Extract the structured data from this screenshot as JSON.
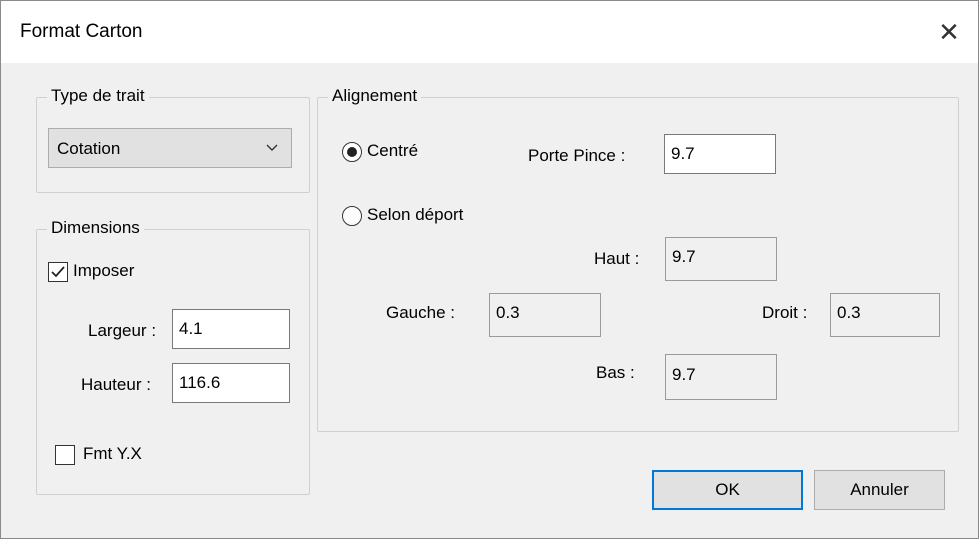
{
  "window": {
    "title": "Format Carton",
    "close_label": "✕"
  },
  "type_de_trait": {
    "label": "Type de trait",
    "selected": "Cotation"
  },
  "dimensions": {
    "label": "Dimensions",
    "imposer_label": "Imposer",
    "imposer_checked": true,
    "largeur_label": "Largeur :",
    "largeur_value": "4.1",
    "hauteur_label": "Hauteur :",
    "hauteur_value": "116.6",
    "fmt_label": "Fmt Y.X",
    "fmt_checked": false
  },
  "alignement": {
    "label": "Alignement",
    "centre_label": "Centré",
    "selon_label": "Selon déport",
    "porte_pince_label": "Porte Pince :",
    "porte_pince_value": "9.7",
    "haut_label": "Haut :",
    "haut_value": "9.7",
    "gauche_label": "Gauche :",
    "gauche_value": "0.3",
    "droit_label": "Droit :",
    "droit_value": "0.3",
    "bas_label": "Bas :",
    "bas_value": "9.7",
    "selected": "centre"
  },
  "buttons": {
    "ok": "OK",
    "annuler": "Annuler"
  }
}
